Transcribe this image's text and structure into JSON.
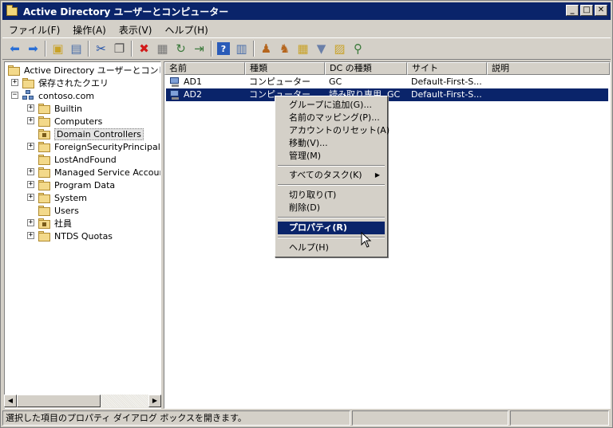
{
  "window": {
    "title": "Active Directory ユーザーとコンピューター",
    "controls": {
      "minimize": "_",
      "maximize": "□",
      "close": "✕"
    }
  },
  "menu": [
    "ファイル(F)",
    "操作(A)",
    "表示(V)",
    "ヘルプ(H)"
  ],
  "toolbar": [
    "back-icon",
    "forward-icon",
    "up-folder-icon",
    "console-tree-icon",
    "cut-icon",
    "copy-icon",
    "delete-icon",
    "properties-icon",
    "refresh-icon",
    "export-icon",
    "help-icon",
    "view-icon",
    "new-user-icon",
    "new-group-icon",
    "new-ou-icon",
    "filter-icon",
    "add-to-group-icon",
    "find-icon"
  ],
  "tree": {
    "root": "Active Directory ユーザーとコンピュータ",
    "saved_queries": "保存されたクエリ",
    "domain": "contoso.com",
    "children": [
      "Builtin",
      "Computers",
      "Domain Controllers",
      "ForeignSecurityPrincipals",
      "LostAndFound",
      "Managed Service Accounts",
      "Program Data",
      "System",
      "Users",
      "社員",
      "NTDS Quotas"
    ]
  },
  "list": {
    "columns": [
      "名前",
      "種類",
      "DC の種類",
      "サイト",
      "説明"
    ],
    "rows": [
      {
        "name": "AD1",
        "type": "コンピューター",
        "dc_type": "GC",
        "site": "Default-First-S...",
        "desc": ""
      },
      {
        "name": "AD2",
        "type": "コンピューター",
        "dc_type": "読み取り専用, GC",
        "site": "Default-First-S...",
        "desc": ""
      }
    ]
  },
  "context_menu": {
    "items": [
      "グループに追加(G)...",
      "名前のマッピング(P)...",
      "アカウントのリセット(A)",
      "移動(V)...",
      "管理(M)"
    ],
    "all_tasks": "すべてのタスク(K)",
    "edit": [
      "切り取り(T)",
      "削除(D)"
    ],
    "properties": "プロパティ(R)",
    "help": "ヘルプ(H)"
  },
  "status": {
    "text": "選択した項目のプロパティ ダイアログ ボックスを開きます。"
  },
  "colors": {
    "selection": "#0a246a",
    "chrome": "#d4d0c8"
  }
}
